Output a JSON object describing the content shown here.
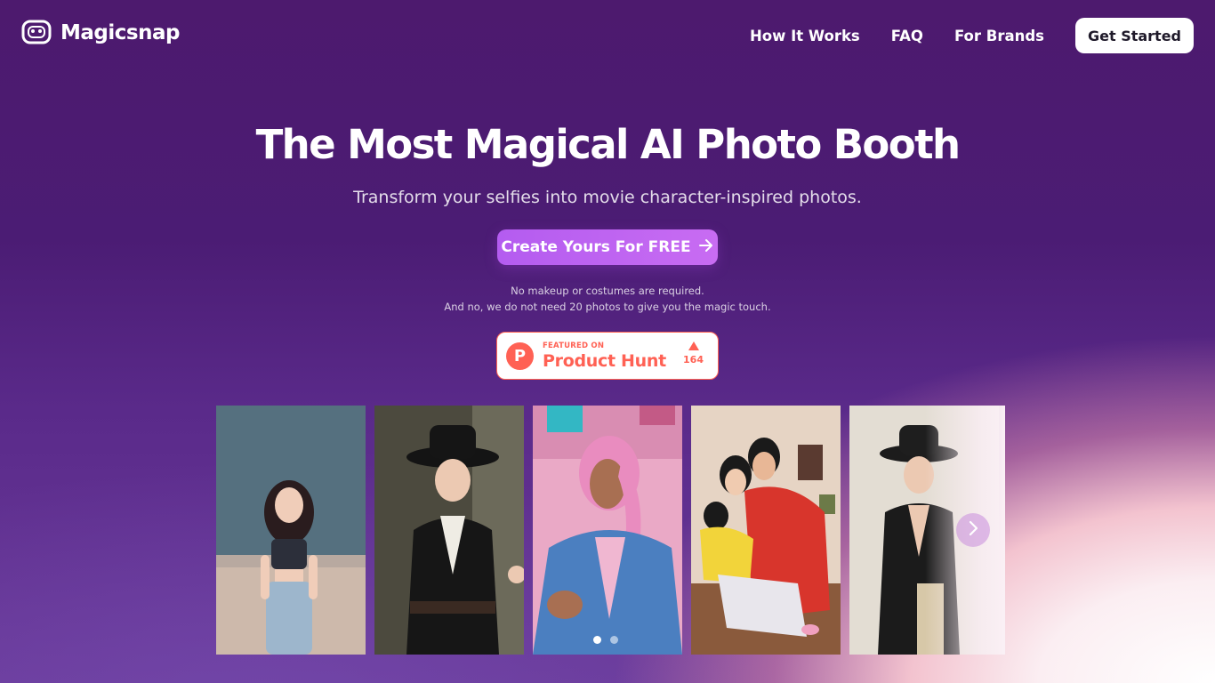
{
  "header": {
    "logo_text": "Magicsnap",
    "nav": [
      {
        "label": "How It Works"
      },
      {
        "label": "FAQ"
      },
      {
        "label": "For Brands"
      }
    ],
    "cta_label": "Get Started"
  },
  "hero": {
    "title": "The Most Magical AI Photo Booth",
    "subtitle": "Transform your selfies into movie character-inspired photos.",
    "cta_label": "Create Yours For FREE",
    "note_line1": "No makeup or costumes are required.",
    "note_line2": "And no, we do not need 20 photos to give you the magic touch."
  },
  "product_hunt": {
    "featured_label": "FEATURED ON",
    "name": "Product Hunt",
    "logo_letter": "P",
    "votes": "164"
  },
  "carousel": {
    "slides": [
      {
        "icon": "anime-girl-photo"
      },
      {
        "icon": "woman-black-hat-photo"
      },
      {
        "icon": "pink-hair-man-photo"
      },
      {
        "icon": "anime-family-photo"
      },
      {
        "icon": "woman-black-dress-photo"
      }
    ],
    "active_dot": 0,
    "dot_count": 2
  },
  "colors": {
    "accent": "#b45cf0",
    "product_hunt": "#ff6154",
    "background_top": "#4d1a6e"
  }
}
